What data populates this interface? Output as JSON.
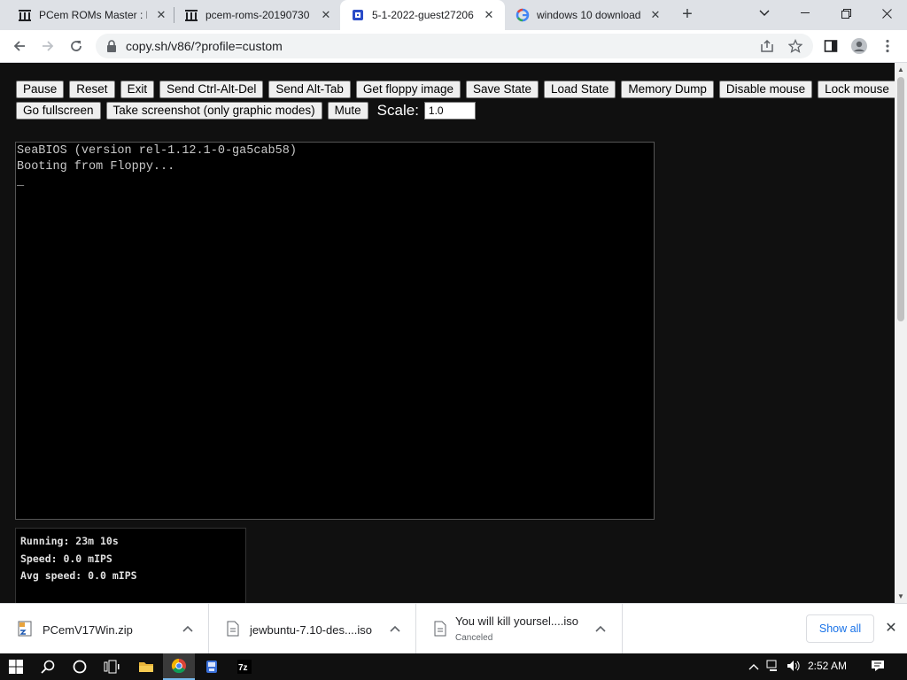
{
  "browser": {
    "tabs": [
      {
        "title": "PCem ROMs Master : F",
        "icon": "archive-icon",
        "active": false
      },
      {
        "title": "pcem-roms-20190730",
        "icon": "archive-icon",
        "active": false
      },
      {
        "title": "5-1-2022-guest27206",
        "icon": "v86-icon",
        "active": true
      },
      {
        "title": "windows 10 download",
        "icon": "google-icon",
        "active": false
      }
    ],
    "url": "copy.sh/v86/?profile=custom"
  },
  "emulator": {
    "buttons_row1": [
      "Pause",
      "Reset",
      "Exit",
      "Send Ctrl-Alt-Del",
      "Send Alt-Tab",
      "Get floppy image",
      "Save State",
      "Load State",
      "Memory Dump",
      "Disable mouse",
      "Lock mouse"
    ],
    "buttons_row2": [
      "Go fullscreen",
      "Take screenshot (only graphic modes)",
      "Mute"
    ],
    "scale_label": "Scale:",
    "scale_value": "1.0",
    "screen_text": "SeaBIOS (version rel-1.12.1-0-ga5cab58)\nBooting from Floppy...\n_",
    "stats": {
      "running": "Running: 23m 10s",
      "speed": "Speed: 0.0 mIPS",
      "avg_speed": "Avg speed: 0.0 mIPS"
    }
  },
  "downloads": {
    "items": [
      {
        "name": "PCemV17Win.zip",
        "status": ""
      },
      {
        "name": "jewbuntu-7.10-des....iso",
        "status": ""
      },
      {
        "name": "You will kill yoursel....iso",
        "status": "Canceled"
      }
    ],
    "show_all": "Show all"
  },
  "taskbar": {
    "clock": "2:52 AM"
  }
}
